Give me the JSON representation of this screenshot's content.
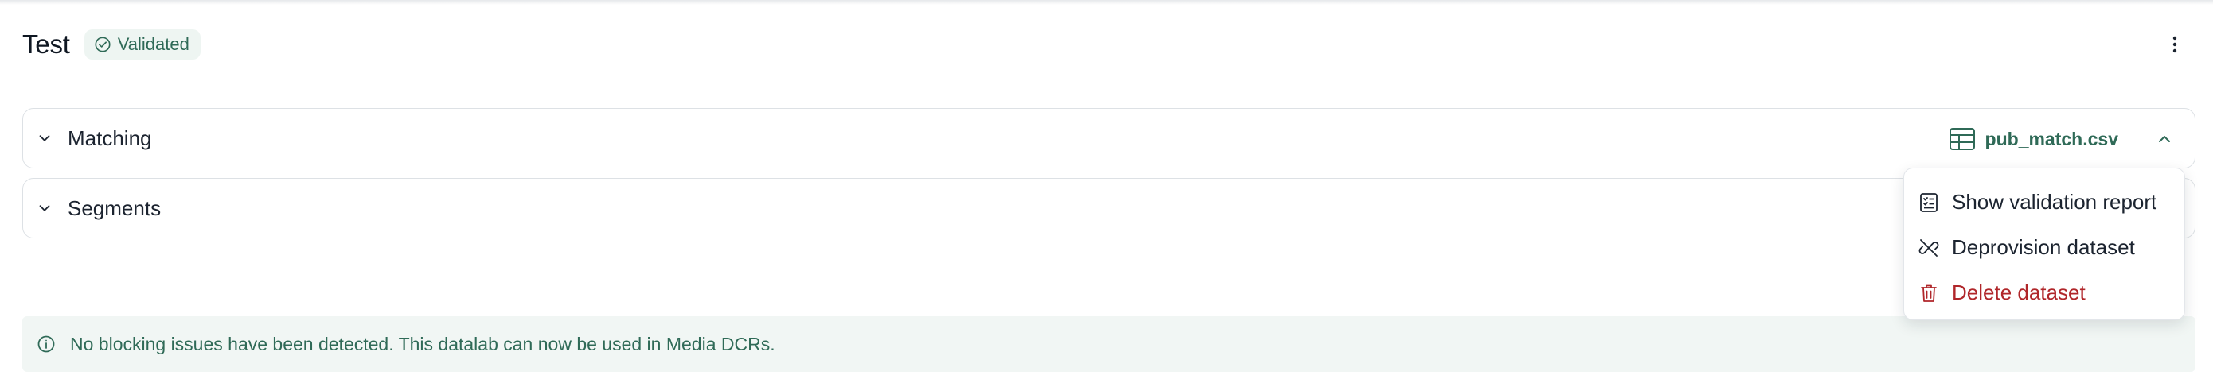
{
  "header": {
    "title": "Test",
    "status_badge": "Validated",
    "more_icon": "more-vertical-icon"
  },
  "sections": [
    {
      "label": "Matching",
      "expand_icon": "chevron-down-icon",
      "file_name": "pub_match.csv",
      "file_icon": "table-icon",
      "collapse_icon": "chevron-up-icon"
    },
    {
      "label": "Segments",
      "expand_icon": "chevron-down-icon"
    }
  ],
  "dropdown_menu": {
    "items": [
      {
        "label": "Show validation report",
        "icon": "checklist-icon"
      },
      {
        "label": "Deprovision dataset",
        "icon": "unlink-icon"
      },
      {
        "label": "Delete dataset",
        "icon": "trash-icon"
      }
    ]
  },
  "info_bar": {
    "icon": "info-icon",
    "message": "No blocking issues have been detected. This datalab can now be used in Media DCRs."
  },
  "colors": {
    "accent_green": "#2f6a57",
    "badge_bg": "#eef5f2",
    "danger_red": "#b0262a",
    "info_bg": "#f1f6f4"
  }
}
